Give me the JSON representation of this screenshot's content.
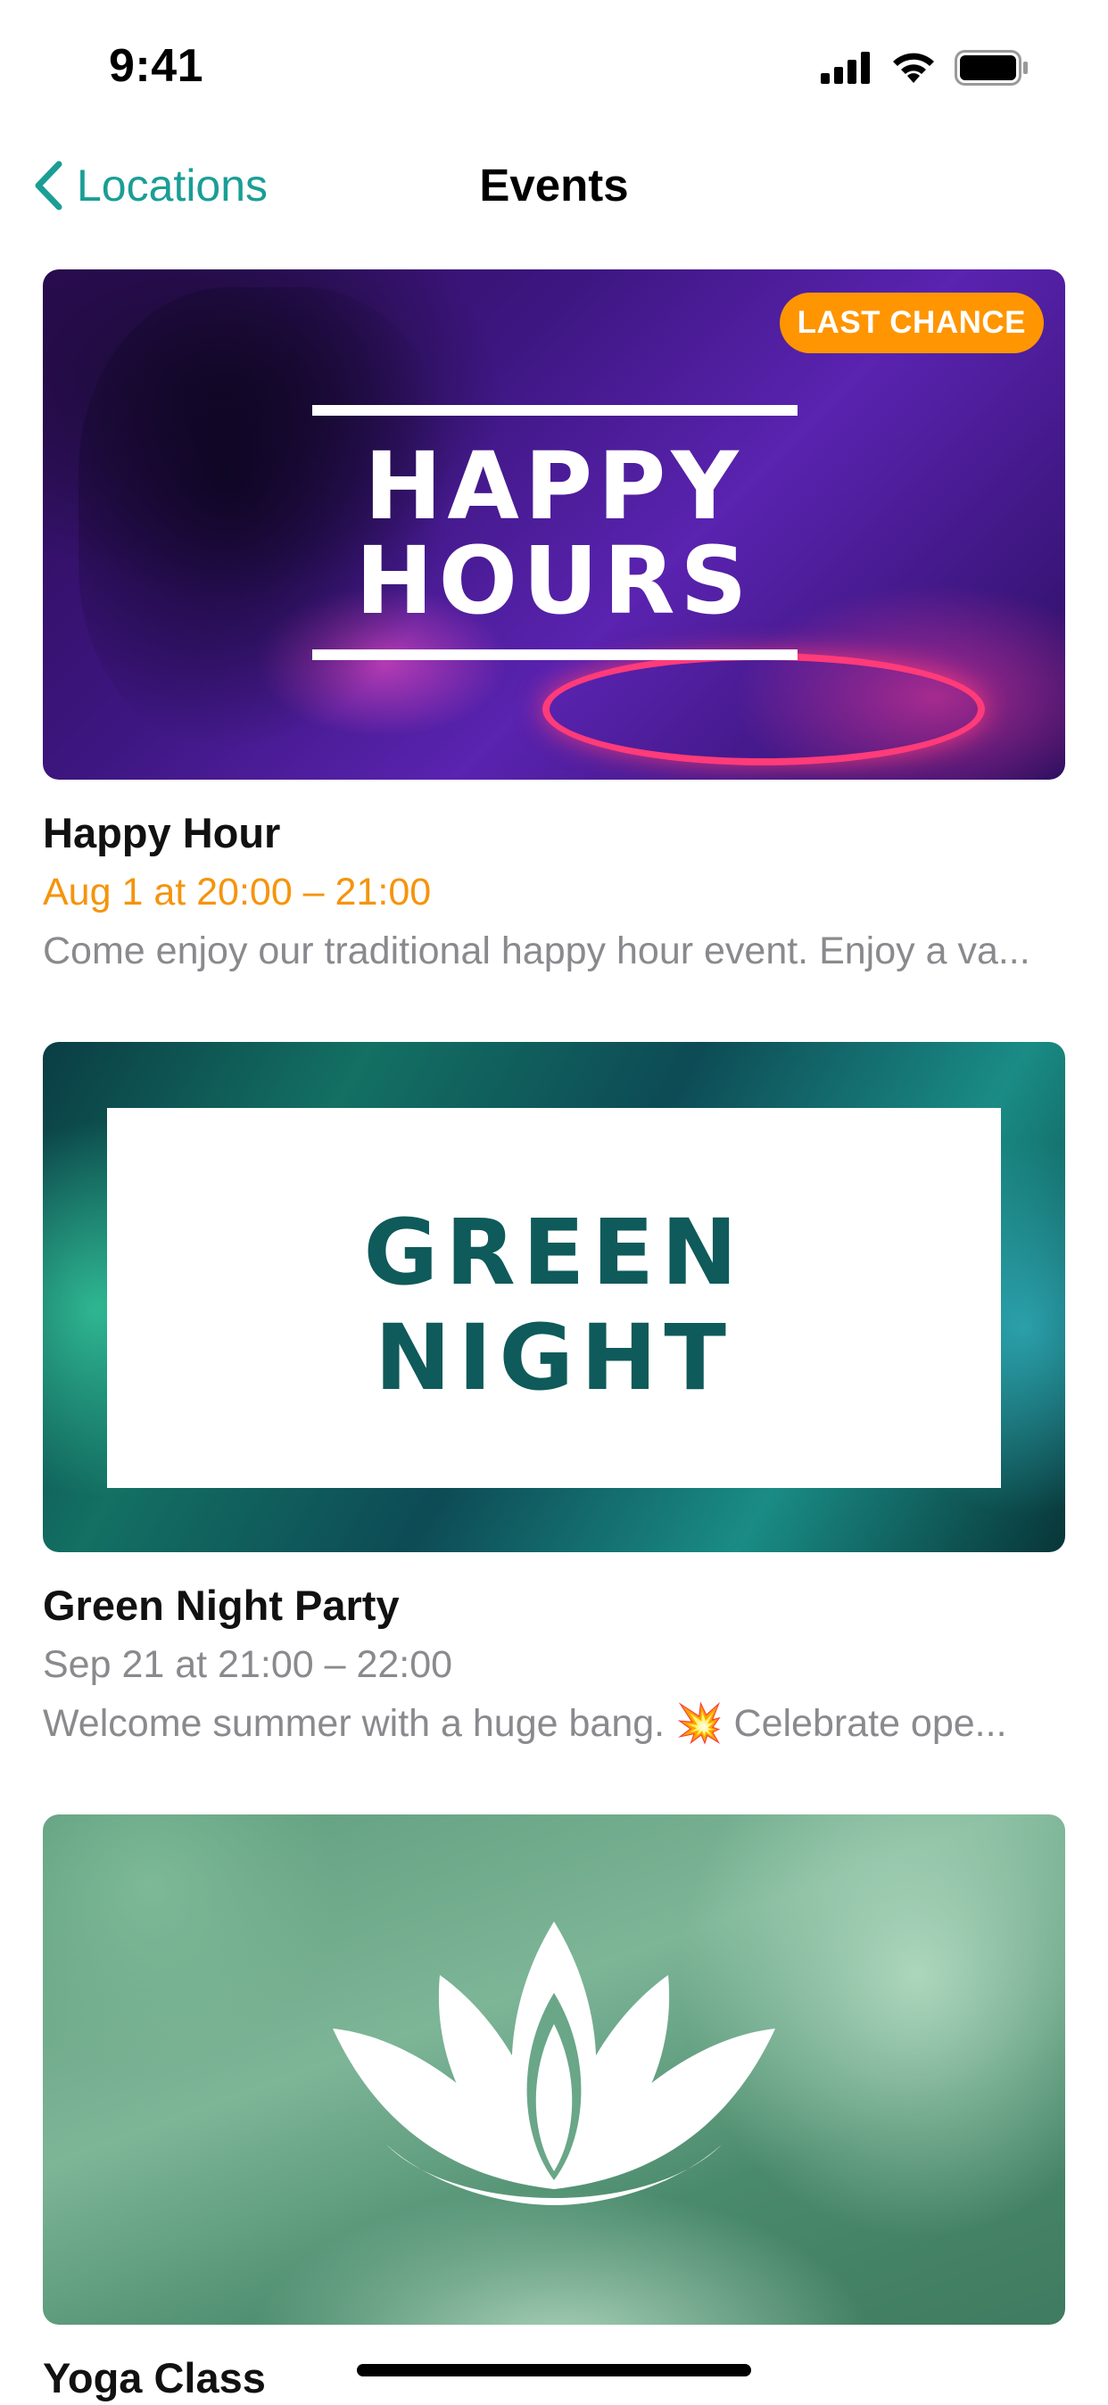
{
  "status_bar": {
    "time": "9:41",
    "icons": [
      "signal-icon",
      "wifi-icon",
      "battery-icon"
    ]
  },
  "nav": {
    "back_label": "Locations",
    "title": "Events",
    "accent_color": "#1a9e96"
  },
  "events": [
    {
      "image_headline": [
        "HAPPY",
        "HOURS"
      ],
      "badge": "LAST CHANCE",
      "badge_color": "#ff9500",
      "title": "Happy Hour",
      "date": "Aug 1 at 20:00 – 21:00",
      "date_color": "#f5940c",
      "description": "Come enjoy our traditional happy hour event. Enjoy a va..."
    },
    {
      "image_headline": [
        "GREEN",
        "NIGHT"
      ],
      "title": "Green Night Party",
      "date": "Sep 21 at 21:00 – 22:00",
      "description_before": "Welcome summer with a huge bang. ",
      "description_emoji": "💥",
      "description_after": " Celebrate ope..."
    },
    {
      "image_icon": "lotus-icon",
      "title": "Yoga Class"
    }
  ]
}
